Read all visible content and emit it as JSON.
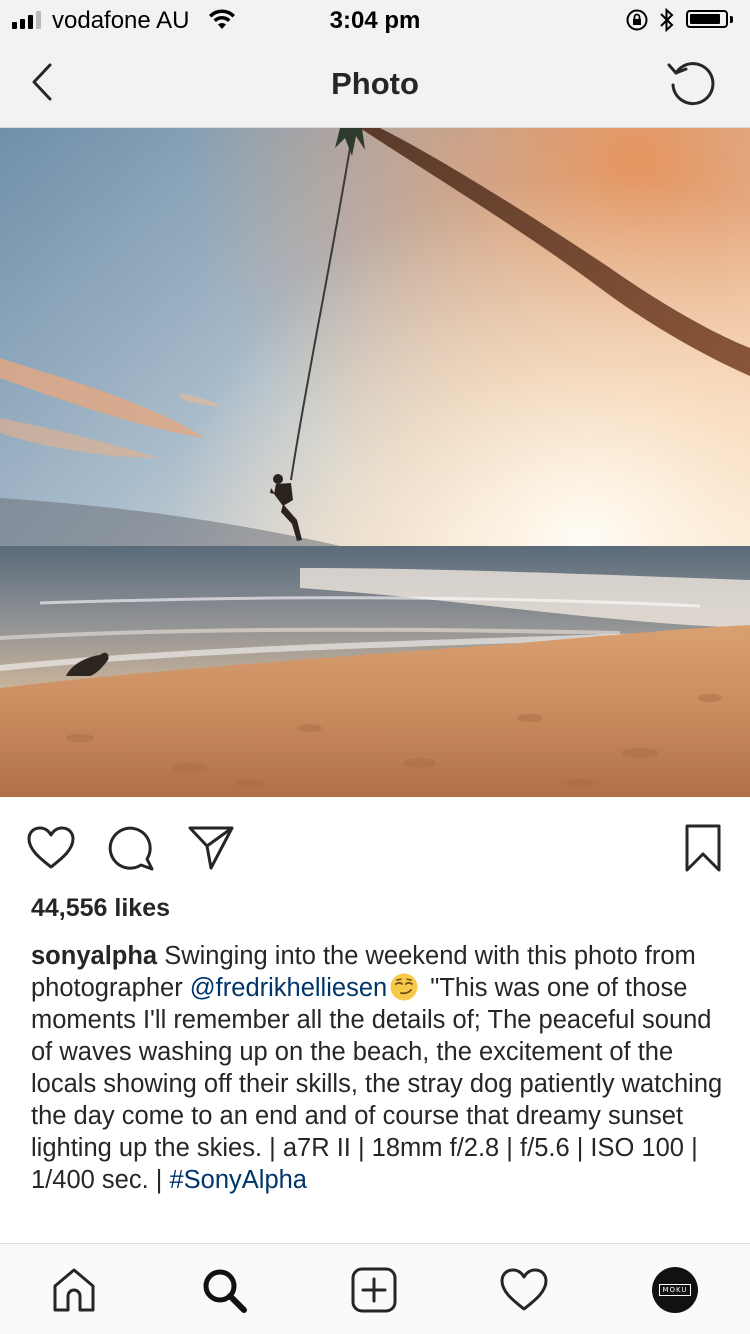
{
  "status_bar": {
    "carrier": "vodafone AU",
    "time": "3:04 pm",
    "signal_bars_active": 3,
    "signal_bars_total": 4,
    "battery_level": 0.75
  },
  "nav": {
    "title": "Photo",
    "back_icon": "chevron-left-icon",
    "refresh_icon": "refresh-icon"
  },
  "post": {
    "likes": "44,556 likes",
    "caption": {
      "username": "sonyalpha",
      "text_1": " Swinging into the weekend with this photo from photographer ",
      "mention": "@fredrikhelliesen",
      "emoji": "smirking-face",
      "text_2": " \"This was one of those moments I'll remember all the details of; The peaceful sound of waves washing up on the beach, the excitement of the locals showing off their skills, the stray dog patiently watching the day come to an end and of course that dreamy sunset lighting up the skies. | a7R II | 18mm f/2.8 | f/5.6 | ISO 100 | 1/400 sec. | ",
      "hashtag": "#SonyAlpha"
    }
  },
  "tab_bar": {
    "items": [
      "home-icon",
      "search-icon",
      "add-post-icon",
      "activity-heart-icon",
      "profile-avatar"
    ],
    "avatar_text": "MOKU"
  },
  "colors": {
    "link": "#003569",
    "text": "#262626",
    "bar_background": "#f2f2f2"
  }
}
